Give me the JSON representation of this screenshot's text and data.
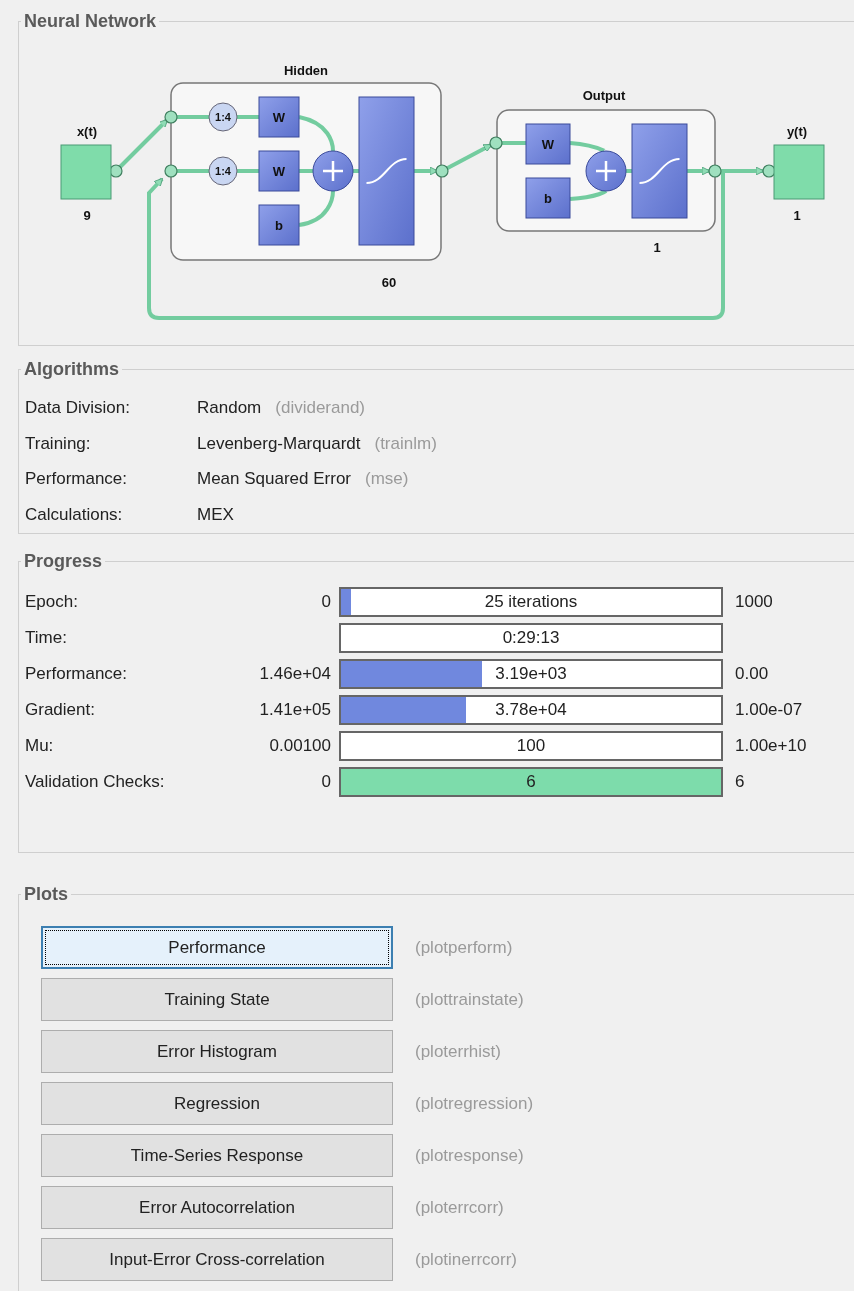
{
  "network": {
    "title": "Neural Network",
    "input": {
      "label": "x(t)",
      "size": "9"
    },
    "hidden": {
      "title": "Hidden",
      "delays": [
        "1:4",
        "1:4"
      ],
      "weights": [
        "W",
        "W"
      ],
      "bias": "b",
      "size": "60"
    },
    "output_layer": {
      "title": "Output",
      "weight": "W",
      "bias": "b",
      "size": "1"
    },
    "output": {
      "label": "y(t)",
      "size": "1"
    }
  },
  "algorithms": {
    "title": "Algorithms",
    "rows": [
      {
        "label": "Data Division:",
        "value": "Random",
        "function": "(dividerand)"
      },
      {
        "label": "Training:",
        "value": "Levenberg-Marquardt",
        "function": "(trainlm)"
      },
      {
        "label": "Performance:",
        "value": "Mean Squared Error",
        "function": "(mse)"
      },
      {
        "label": "Calculations:",
        "value": "MEX"
      }
    ]
  },
  "progress": {
    "title": "Progress",
    "rows": [
      {
        "label": "Epoch:",
        "kind": "progress",
        "start": "0",
        "bar_text": "25 iterations",
        "level": 0.025,
        "end": "1000"
      },
      {
        "label": "Time:",
        "kind": "text",
        "bar_text": "0:29:13"
      },
      {
        "label": "Performance:",
        "kind": "progress",
        "start": "1.46e+04",
        "bar_text": "3.19e+03",
        "level": 0.37,
        "end": "0.00"
      },
      {
        "label": "Gradient:",
        "kind": "progress",
        "start": "1.41e+05",
        "bar_text": "3.78e+04",
        "level": 0.33,
        "end": "1.00e-07"
      },
      {
        "label": "Mu:",
        "kind": "progress",
        "start": "0.00100",
        "bar_text": "100",
        "level": 0,
        "end": "1.00e+10"
      },
      {
        "label": "Validation Checks:",
        "kind": "check",
        "start": "0",
        "bar_text": "6",
        "level": 1,
        "end": "6"
      }
    ]
  },
  "plots": {
    "title": "Plots",
    "buttons": [
      {
        "label": "Performance",
        "function": "(plotperform)",
        "focused": true
      },
      {
        "label": "Training State",
        "function": "(plottrainstate)",
        "focused": false
      },
      {
        "label": "Error Histogram",
        "function": "(ploterrhist)",
        "focused": false
      },
      {
        "label": "Regression",
        "function": "(plotregression)",
        "focused": false
      },
      {
        "label": "Time-Series Response",
        "function": "(plotresponse)",
        "focused": false
      },
      {
        "label": "Error Autocorrelation",
        "function": "(ploterrcorr)",
        "focused": false
      },
      {
        "label": "Input-Error Cross-correlation",
        "function": "(plotinerrcorr)",
        "focused": false
      }
    ]
  }
}
